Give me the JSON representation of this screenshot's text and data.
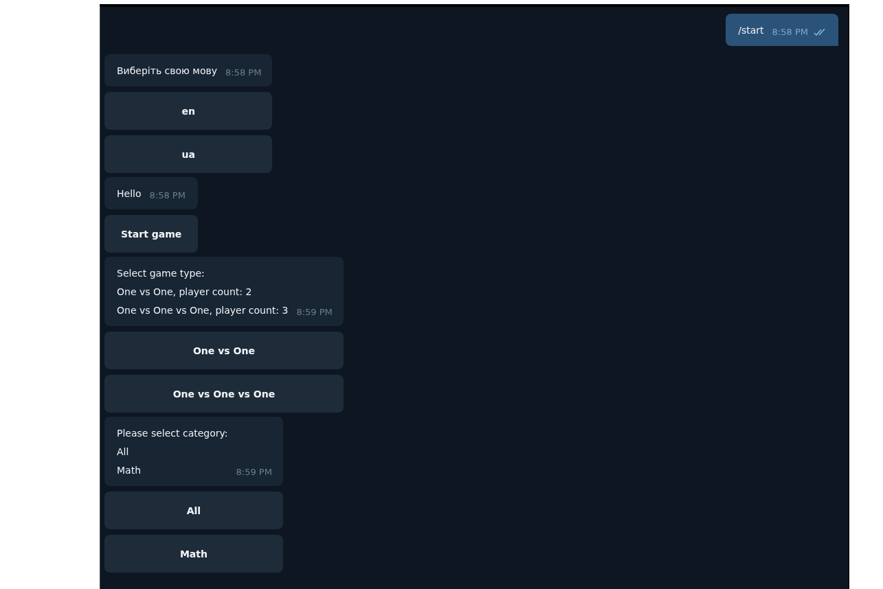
{
  "messages": [
    {
      "kind": "sent",
      "text": "/start",
      "time": "8:58 PM",
      "read": true
    },
    {
      "kind": "received",
      "text": "Виберіть свою мову",
      "time": "8:58 PM",
      "keyboard": [
        "en",
        "ua"
      ]
    },
    {
      "kind": "received",
      "text": "Hello",
      "time": "8:58 PM",
      "keyboard": [
        "Start game"
      ]
    },
    {
      "kind": "received",
      "text": "Select game type:\nOne vs One, player count: 2\nOne vs One vs One, player count: 3",
      "time": "8:59 PM",
      "keyboard": [
        "One vs One",
        "One vs One vs One"
      ]
    },
    {
      "kind": "received",
      "text": "Please select category:\nAll\nMath",
      "time": "8:59 PM",
      "keyboard": [
        "All",
        "Math"
      ]
    }
  ]
}
